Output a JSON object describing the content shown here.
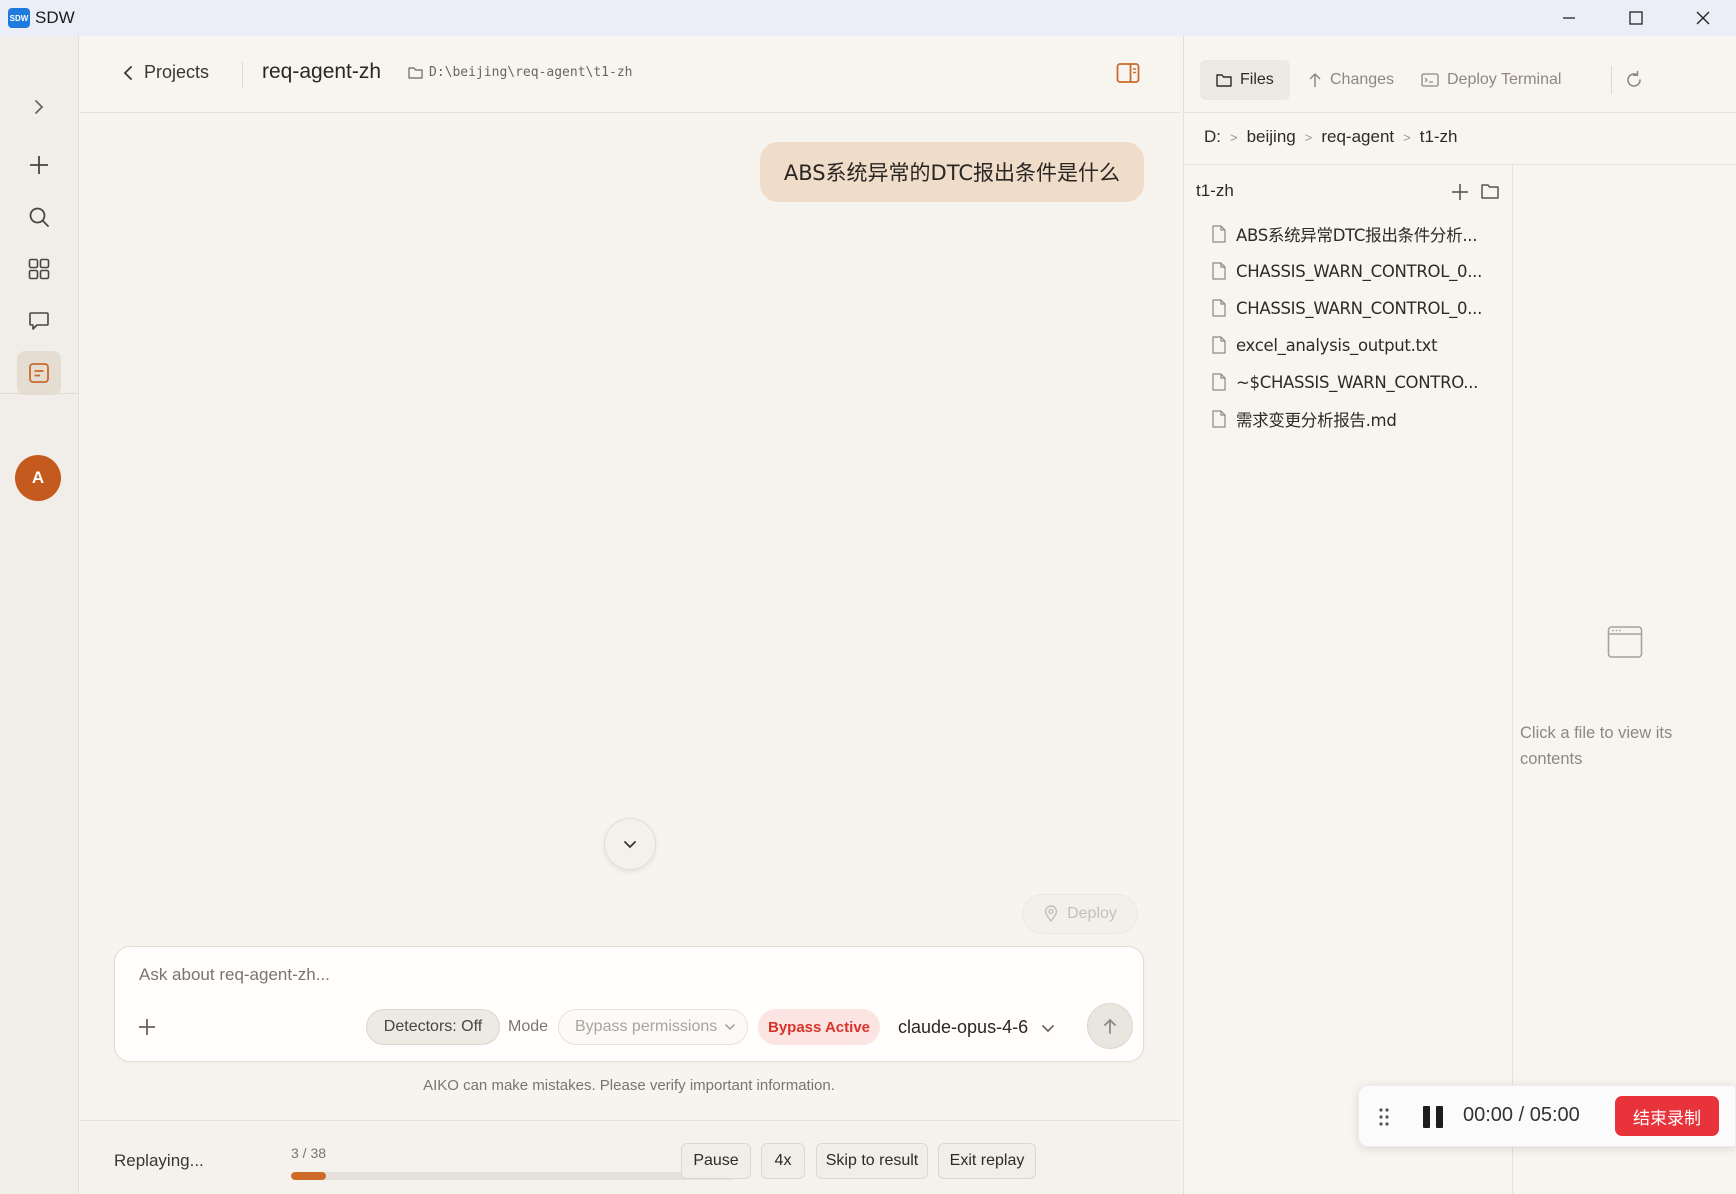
{
  "window": {
    "app_title": "SDW",
    "logo_text": "SDW"
  },
  "header": {
    "back_label": "Projects",
    "project_name": "req-agent-zh",
    "project_path": "D:\\beijing\\req-agent\\t1-zh"
  },
  "chat": {
    "user_message": "ABS系统异常的DTC报出条件是什么",
    "deploy_label": "Deploy"
  },
  "composer": {
    "placeholder": "Ask about req-agent-zh...",
    "detectors_label": "Detectors: Off",
    "mode_label": "Mode",
    "mode_value": "Bypass permissions",
    "bypass_badge": "Bypass Active",
    "model": "claude-opus-4-6",
    "disclaimer": "AIKO can make mistakes. Please verify important information."
  },
  "replay": {
    "status": "Replaying...",
    "counter": "3 / 38",
    "progress": 0.079,
    "pause_label": "Pause",
    "speed_label": "4x",
    "skip_label": "Skip to result",
    "exit_label": "Exit replay"
  },
  "right_panel": {
    "tabs": [
      {
        "label": "Files",
        "active": true
      },
      {
        "label": "Changes",
        "active": false
      },
      {
        "label": "Deploy Terminal",
        "active": false
      }
    ],
    "breadcrumb": [
      "D:",
      "beijing",
      "req-agent",
      "t1-zh"
    ],
    "tree_root": "t1-zh",
    "files": [
      "ABS系统异常DTC报出条件分析...",
      "CHASSIS_WARN_CONTROL_0...",
      "CHASSIS_WARN_CONTROL_0...",
      "excel_analysis_output.txt",
      "~$CHASSIS_WARN_CONTRO...",
      "需求变更分析报告.md"
    ],
    "empty_preview": "Click a file to view its contents"
  },
  "recorder": {
    "time": "00:00 / 05:00",
    "stop_label": "结束录制"
  },
  "user": {
    "avatar_initial": "A"
  },
  "colors": {
    "accent": "#cf6b2a",
    "user_bubble": "#efdcc9",
    "bypass_red": "#d8342b",
    "record_red": "#e8333b",
    "avatar": "#c45a1d"
  }
}
